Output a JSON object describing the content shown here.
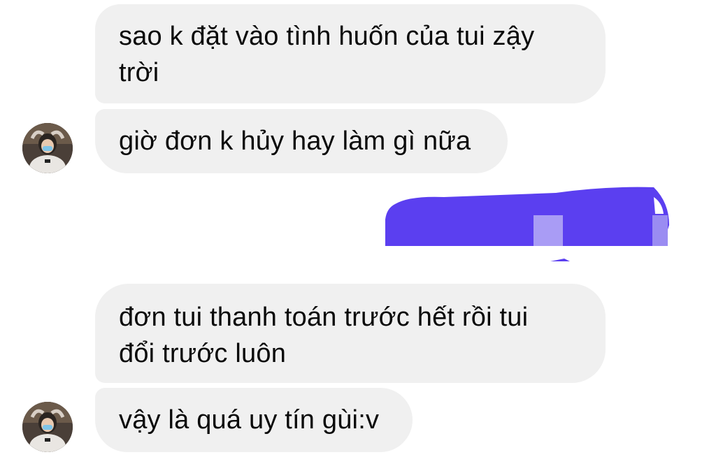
{
  "messages": [
    {
      "id": "m1",
      "sender": "other",
      "lines": [
        "sao k đặt vào tình huốn của tui zậy",
        "trời"
      ]
    },
    {
      "id": "m2",
      "sender": "other",
      "lines": [
        "giờ đơn k hủy hay làm gì nữa"
      ]
    },
    {
      "id": "m3",
      "sender": "other",
      "lines": [
        "đơn tui thanh toán trước hết rồi tui",
        "đổi trước luôn"
      ]
    },
    {
      "id": "m4",
      "sender": "other",
      "lines": [
        "vậy là quá uy tín gùi:v"
      ]
    }
  ],
  "colors": {
    "incoming_bubble": "#f0f0f0",
    "text": "#0a0a0a",
    "redaction": "#5b3ff0"
  },
  "icons": {
    "avatar": "user-avatar-photo"
  }
}
